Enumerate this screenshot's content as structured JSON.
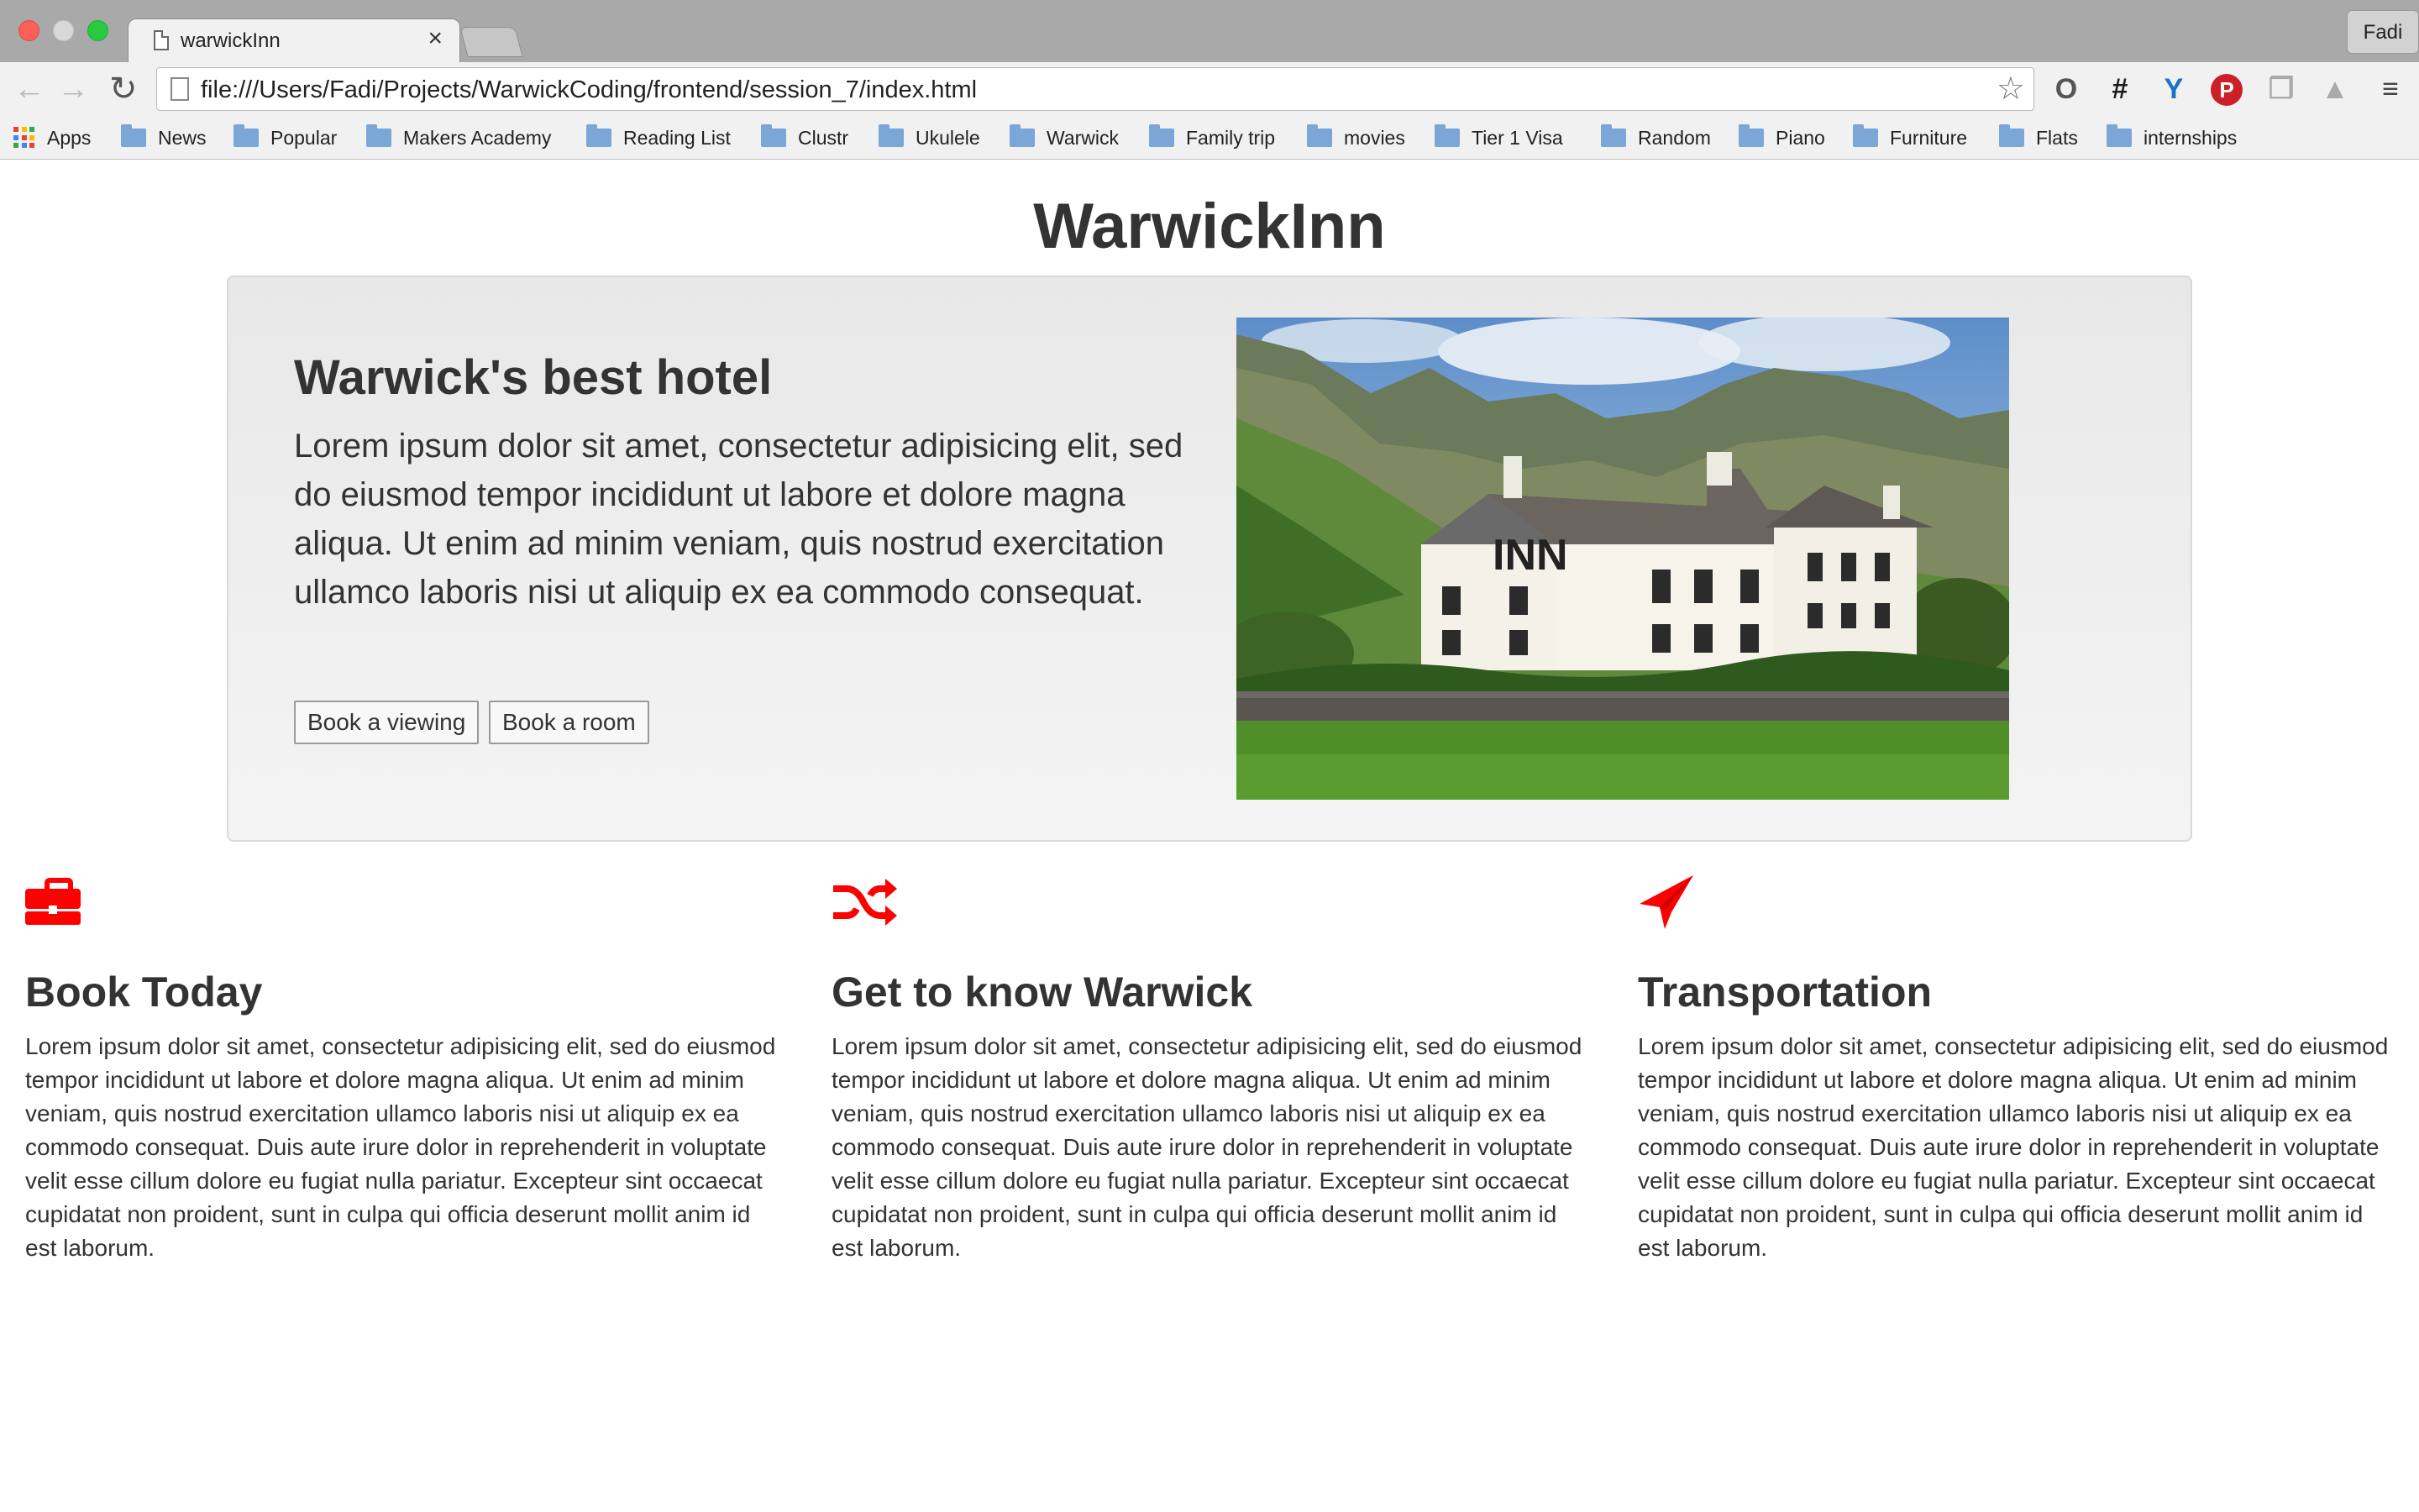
{
  "browser": {
    "tab_title": "warwickInn",
    "tab_close": "×",
    "profile_name": "Fadi",
    "url": "file:///Users/Fadi/Projects/WarwickCoding/frontend/session_7/index.html",
    "nav": {
      "back": "←",
      "forward": "→",
      "reload": "↻",
      "star": "☆"
    },
    "extensions": [
      "O",
      "#",
      "Y",
      "P",
      "❐",
      "▲",
      "≡"
    ],
    "bookmarks": [
      "Apps",
      "News",
      "Popular",
      "Makers Academy",
      "Reading List",
      "Clustr",
      "Ukulele",
      "Warwick",
      "Family trip",
      "movies",
      "Tier 1 Visa",
      "Random",
      "Piano",
      "Furniture",
      "Flats",
      "internships"
    ]
  },
  "page": {
    "site_title": "WarwickInn",
    "hero": {
      "heading": "Warwick's best hotel",
      "text": "Lorem ipsum dolor sit amet, consectetur adipisicing elit, sed do eiusmod tempor incididunt ut labore et dolore magna aliqua. Ut enim ad minim veniam, quis nostrud exercitation ullamco laboris nisi ut aliquip ex ea commodo consequat.",
      "buttons": {
        "viewing": "Book a viewing",
        "room": "Book a room"
      },
      "photo_sign": "INN"
    },
    "features": [
      {
        "icon": "briefcase-icon",
        "title": "Book Today",
        "text": "Lorem ipsum dolor sit amet, consectetur adipisicing elit, sed do eiusmod tempor incididunt ut labore et dolore magna aliqua. Ut enim ad minim veniam, quis nostrud exercitation ullamco laboris nisi ut aliquip ex ea commodo consequat. Duis aute irure dolor in reprehenderit in voluptate velit esse cillum dolore eu fugiat nulla pariatur. Excepteur sint occaecat cupidatat non proident, sunt in culpa qui officia deserunt mollit anim id est laborum."
      },
      {
        "icon": "shuffle-icon",
        "title": "Get to know Warwick",
        "text": "Lorem ipsum dolor sit amet, consectetur adipisicing elit, sed do eiusmod tempor incididunt ut labore et dolore magna aliqua. Ut enim ad minim veniam, quis nostrud exercitation ullamco laboris nisi ut aliquip ex ea commodo consequat. Duis aute irure dolor in reprehenderit in voluptate velit esse cillum dolore eu fugiat nulla pariatur. Excepteur sint occaecat cupidatat non proident, sunt in culpa qui officia deserunt mollit anim id est laborum."
      },
      {
        "icon": "paper-plane-icon",
        "title": "Transportation",
        "text": "Lorem ipsum dolor sit amet, consectetur adipisicing elit, sed do eiusmod tempor incididunt ut labore et dolore magna aliqua. Ut enim ad minim veniam, quis nostrud exercitation ullamco laboris nisi ut aliquip ex ea commodo consequat. Duis aute irure dolor in reprehenderit in voluptate velit esse cillum dolore eu fugiat nulla pariatur. Excepteur sint occaecat cupidatat non proident, sunt in culpa qui officia deserunt mollit anim id est laborum."
      }
    ]
  },
  "colors": {
    "accent": "#ff0000",
    "heading": "#333333",
    "jumbotron_bg": "#eeeeee"
  }
}
